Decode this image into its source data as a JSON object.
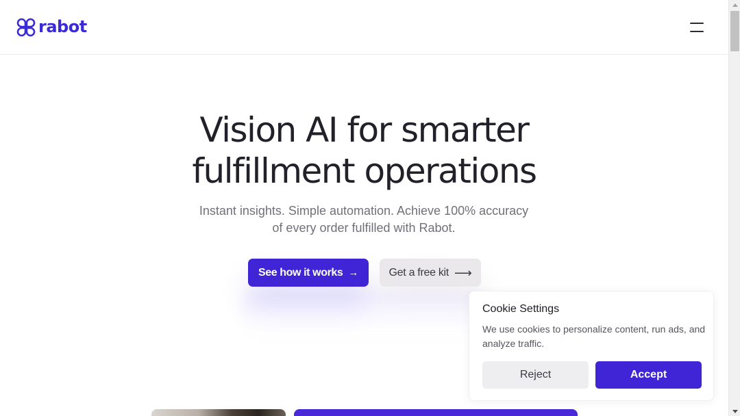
{
  "brand": {
    "name": "rabot",
    "color": "#3b2bd6"
  },
  "header": {
    "menu_icon": "hamburger-menu-icon"
  },
  "hero": {
    "title_line1": "Vision AI for smarter",
    "title_line2": "fulfillment operations",
    "subtitle_line1": "Instant insights. Simple automation. Achieve 100% accuracy",
    "subtitle_line2": "of every order fulfilled with Rabot.",
    "primary_cta": {
      "label": "See how it works",
      "icon": "arrow-right-icon",
      "arrow": "→",
      "color": "#3f25d6"
    },
    "secondary_cta": {
      "label": "Get a free kit",
      "icon": "arrow-right-icon",
      "arrow": "⟶"
    }
  },
  "cookie_banner": {
    "title": "Cookie Settings",
    "text": "We use cookies to personalize content, run ads, and analyze traffic.",
    "reject_label": "Reject",
    "accept_label": "Accept",
    "accept_color": "#3f25d6"
  }
}
